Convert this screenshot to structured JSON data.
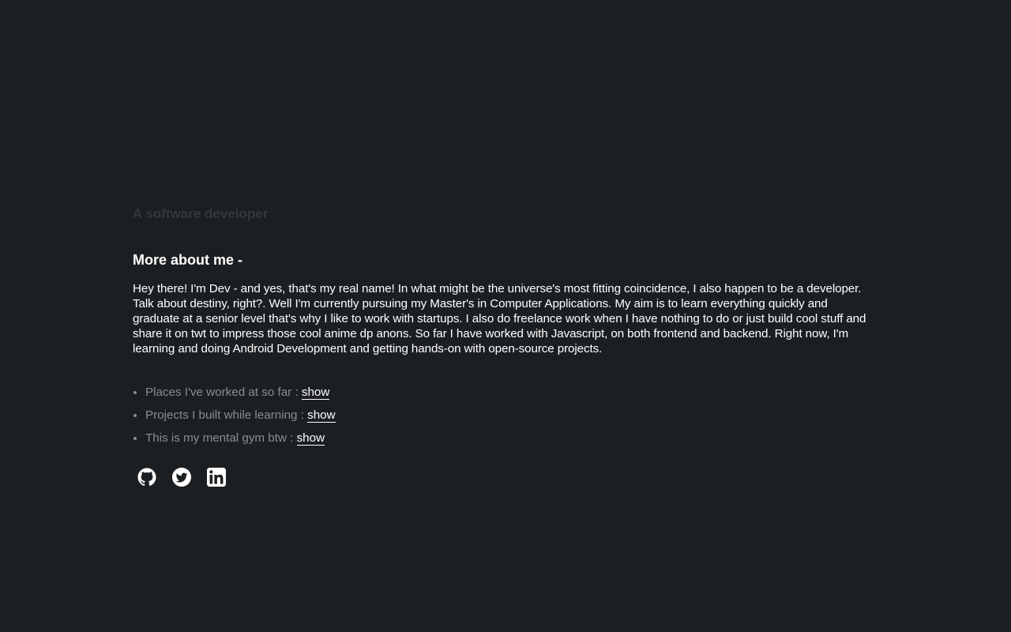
{
  "header": {
    "subtitle": "A software developer"
  },
  "about": {
    "heading": "More about me -",
    "bio": "Hey there! I'm Dev - and yes, that's my real name! In what might be the universe's most fitting coincidence, I also happen to be a developer. Talk about destiny, right?. Well I'm currently pursuing my Master's in Computer Applications. My aim is to learn everything quickly and graduate at a senior level that's why I like to work with startups. I also do freelance work when I have nothing to do or just build cool stuff and share it on twt to impress those cool anime dp anons. So far I have worked with Javascript, on both frontend and backend. Right now, I'm learning and doing Android Development and getting hands-on with open-source projects."
  },
  "links": [
    {
      "label": "Places I've worked at so far : ",
      "action": "show"
    },
    {
      "label": "Projects I built while learning : ",
      "action": "show"
    },
    {
      "label": "This is my mental gym btw : ",
      "action": "show"
    }
  ],
  "socials": [
    {
      "icon": "github-icon"
    },
    {
      "icon": "twitter-icon"
    },
    {
      "icon": "linkedin-icon"
    }
  ],
  "colors": {
    "background": "#1c1f22",
    "text": "#ffffff",
    "muted": "#8a8d90",
    "subtitle": "#34383c"
  }
}
